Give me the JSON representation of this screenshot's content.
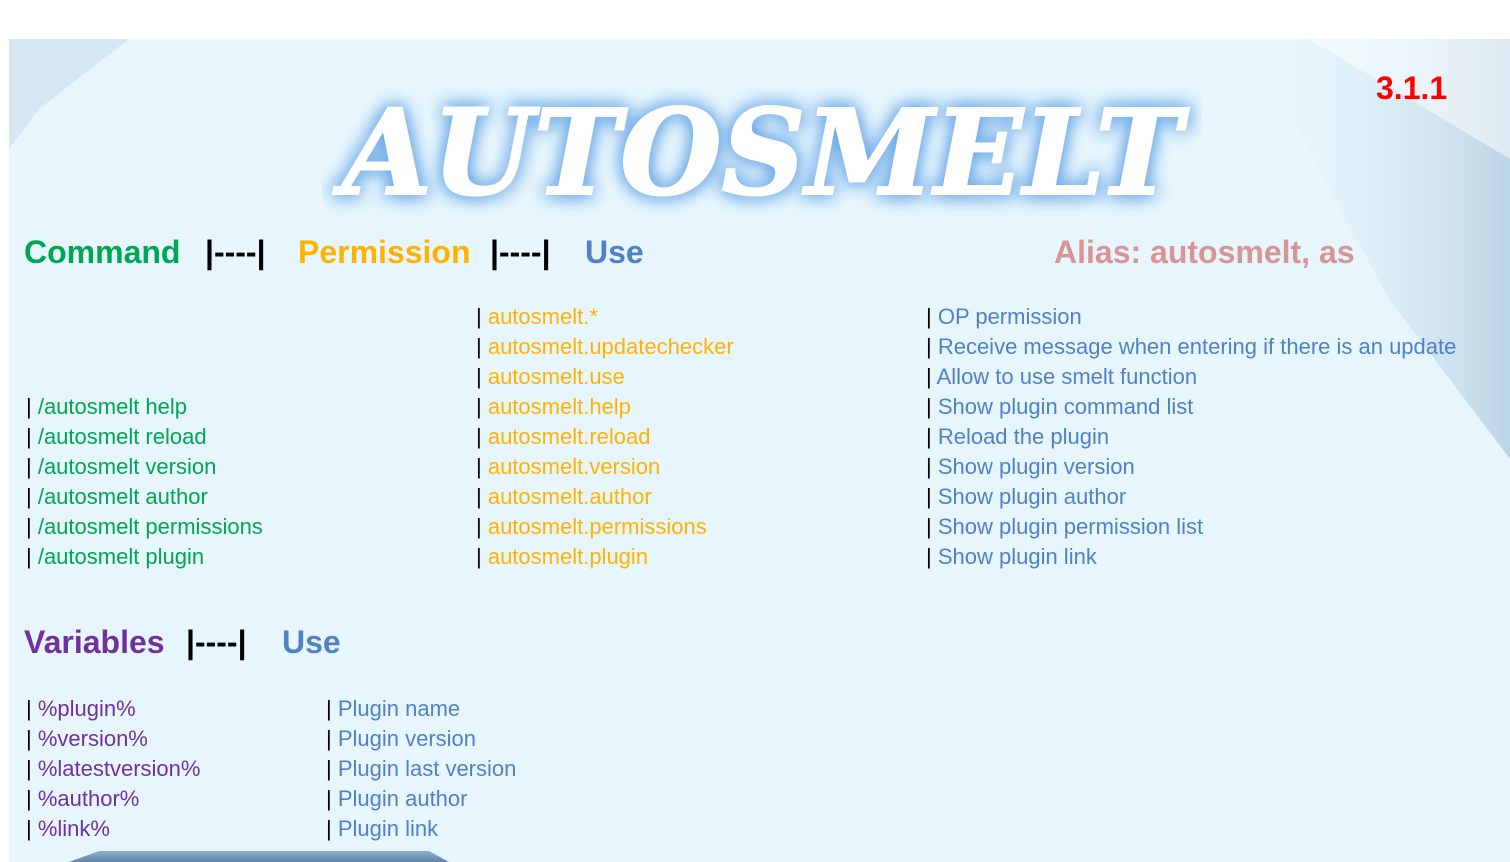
{
  "logo_text": "AUTOSMELT",
  "version": "3.1.1",
  "colors": {
    "command": "#00a651",
    "permission": "#ffb300",
    "use": "#4f81c7",
    "alias": "#d99594",
    "variables": "#7030a0",
    "version": "#ff0000"
  },
  "header": {
    "command": "Command",
    "sep1": "|----|",
    "permission": "Permission",
    "sep2": "|----|",
    "use": "Use",
    "alias": "Alias: autosmelt, as"
  },
  "rows": [
    {
      "command": "",
      "permission": "autosmelt.*",
      "use": "OP permission"
    },
    {
      "command": "",
      "permission": "autosmelt.updatechecker",
      "use": "Receive message when entering if there is an update"
    },
    {
      "command": "",
      "permission": "autosmelt.use",
      "use": "Allow to use smelt function"
    },
    {
      "command": "/autosmelt help",
      "permission": "autosmelt.help",
      "use": "Show plugin command list"
    },
    {
      "command": "/autosmelt reload",
      "permission": "autosmelt.reload",
      "use": "Reload the plugin"
    },
    {
      "command": "/autosmelt version",
      "permission": "autosmelt.version",
      "use": "Show plugin version"
    },
    {
      "command": "/autosmelt author",
      "permission": "autosmelt.author",
      "use": "Show plugin author"
    },
    {
      "command": "/autosmelt permissions",
      "permission": "autosmelt.permissions",
      "use": "Show plugin permission list"
    },
    {
      "command": "/autosmelt plugin",
      "permission": "autosmelt.plugin",
      "use": "Show plugin link"
    }
  ],
  "variables_header": {
    "variables": "Variables",
    "sep": "|----|",
    "use": "Use"
  },
  "variables": [
    {
      "name": "%plugin%",
      "use": "Plugin name"
    },
    {
      "name": "%version%",
      "use": "Plugin version"
    },
    {
      "name": "%latestversion%",
      "use": "Plugin last version"
    },
    {
      "name": "%author%",
      "use": "Plugin author"
    },
    {
      "name": "%link%",
      "use": "Plugin link"
    }
  ]
}
